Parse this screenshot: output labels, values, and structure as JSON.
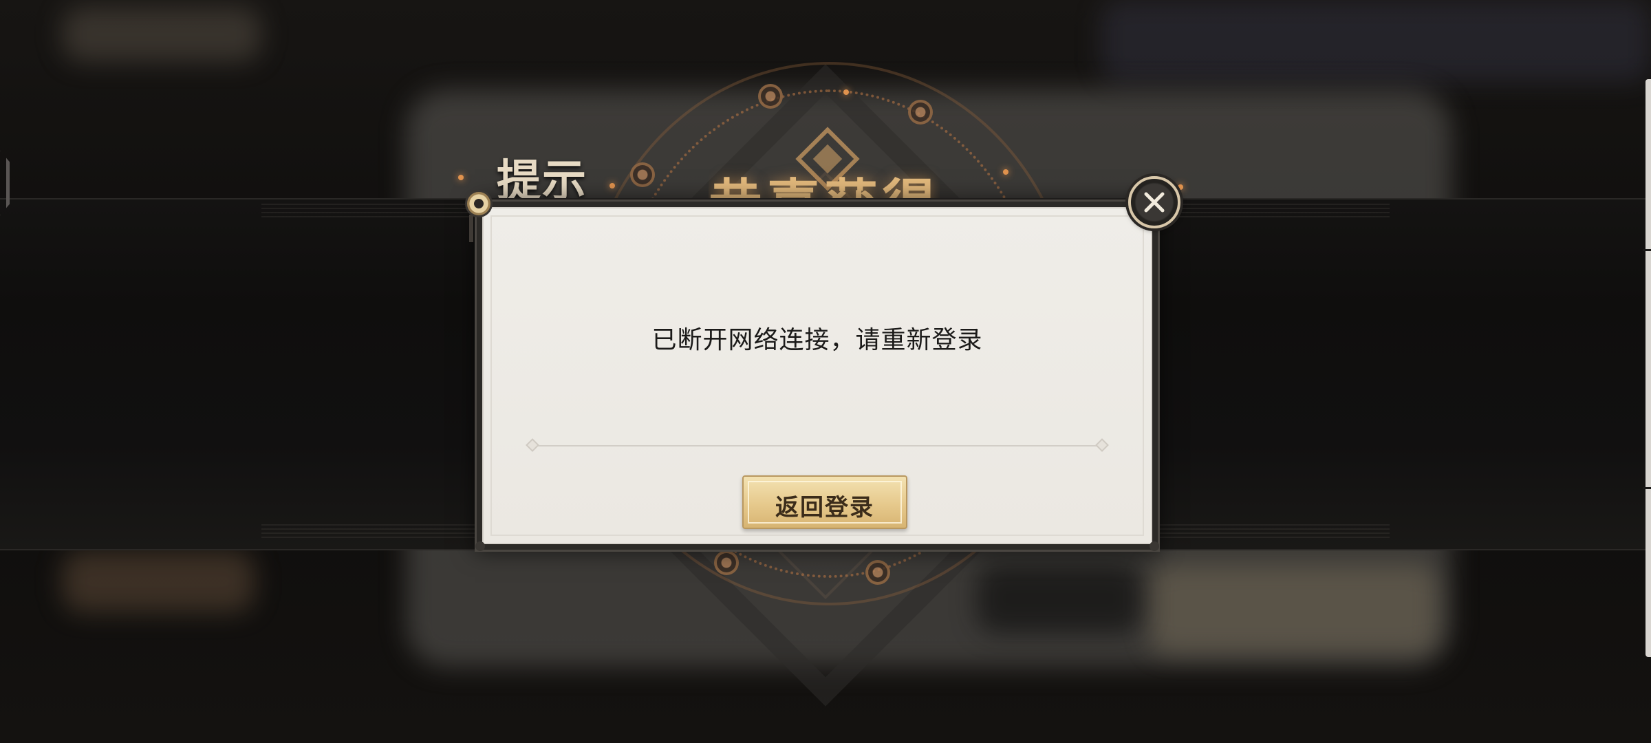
{
  "background": {
    "hint_title": "提示",
    "big_title": "恭喜获得"
  },
  "dialog": {
    "message": "已断开网络连接，请重新登录",
    "return_button_label": "返回登录",
    "close_icon": "close-icon",
    "pin_icon": "pin-icon"
  },
  "colors": {
    "dialog_background": "#ebe8e2",
    "button_gold": "#e6c98c",
    "frame_dark": "#2c2a27",
    "accent_orange": "#e1934e"
  }
}
